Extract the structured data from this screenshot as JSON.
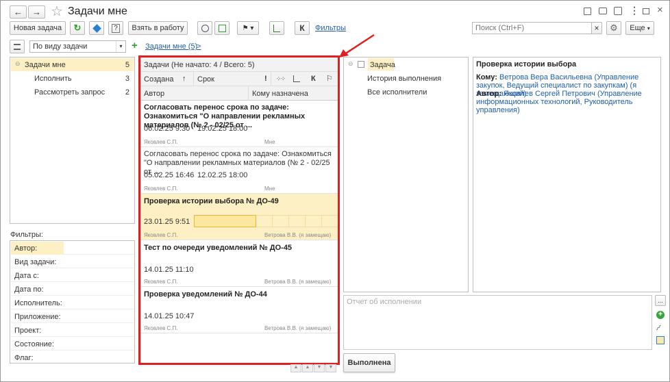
{
  "window": {
    "title": "Задачи мне",
    "nav_back": "←",
    "nav_forward": "→",
    "star": "☆"
  },
  "toolbar": {
    "new_task": "Новая задача",
    "take_to_work": "Взять в работу",
    "flag_menu": "⚑ ▾",
    "k_label": "К",
    "filters_link": "Фильтры",
    "search_placeholder": "Поиск (Ctrl+F)",
    "search_clear": "×",
    "more": "Еще"
  },
  "subtoolbar": {
    "group_by": "По виду задачи",
    "tab_link": "Задачи мне (5)",
    "tab_arrow": ">",
    "plus": "+"
  },
  "groups": [
    {
      "label": "Задачи мне",
      "count": "5"
    },
    {
      "label": "Исполнить",
      "count": "3"
    },
    {
      "label": "Рассмотреть запрос",
      "count": "2"
    }
  ],
  "filters": {
    "title": "Фильтры:",
    "items": [
      "Автор:",
      "Вид задачи:",
      "Дата с:",
      "Дата по:",
      "Исполнитель:",
      "Приложение:",
      "Проект:",
      "Состояние:",
      "Флаг:"
    ]
  },
  "task_list": {
    "header": "Задачи (Не начато: 4 / Всего: 5)",
    "col_created": "Создана",
    "sort_arrow": "↑",
    "col_due": "Срок",
    "col_author": "Автор",
    "col_assignee": "Кому назначена",
    "icon_excl": "!",
    "icon_k": "К",
    "tasks": [
      {
        "title": "Согласовать перенос срока по задаче: Ознакомиться \"О направлении рекламных материалов (№ 2 - 02/25 от ...",
        "created": "06.02.25 9:30",
        "due": "19.02.25 18:00",
        "author": "Яковлев С.П.",
        "assignee": "Мне"
      },
      {
        "title": "Согласовать перенос срока по задаче: Ознакомиться  \"О направлении рекламных материалов (№ 2 - 02/25 от ...",
        "created": "05.02.25 16:46",
        "due": "12.02.25 18:00",
        "author": "Яковлев С.П.",
        "assignee": "Мне"
      },
      {
        "title": "Проверка истории выбора № ДО-49",
        "created": "23.01.25 9:51",
        "due": "",
        "author": "Яковлев С.П.",
        "assignee": "Ветрова В.В. (я замещаю)"
      },
      {
        "title": "Тест по очереди уведомлений № ДО-45",
        "created": "14.01.25 11:10",
        "due": "",
        "author": "Яковлев С.П.",
        "assignee": "Ветрова В.В. (я замещаю)"
      },
      {
        "title": "Проверка уведомлений № ДО-44",
        "created": "14.01.25 10:47",
        "due": "",
        "author": "Яковлев С.П.",
        "assignee": "Ветрова В.В. (я замещаю)"
      }
    ]
  },
  "tree": {
    "root": "Задача",
    "children": [
      "История выполнения",
      "Все исполнители"
    ],
    "expander": "⊖"
  },
  "detail": {
    "title": "Проверка истории выбора",
    "to_label": "Кому:",
    "to_value": "Ветрова Вера Васильевна (Управление закупок, Ведущий специалист по закупкам) (я замещающий)",
    "author_label": "Автор:",
    "author_value": "Яковлев Сергей Петрович (Управление информационных технологий, Руководитель управления)"
  },
  "report": {
    "placeholder": "Отчет об исполнении",
    "more": "..."
  },
  "actions": {
    "done": "Выполнена"
  },
  "colors": {
    "highlight_red": "#e02020",
    "selected_row": "#fdf0c4",
    "link": "#1f5fa8",
    "green": "#3aa53a"
  }
}
